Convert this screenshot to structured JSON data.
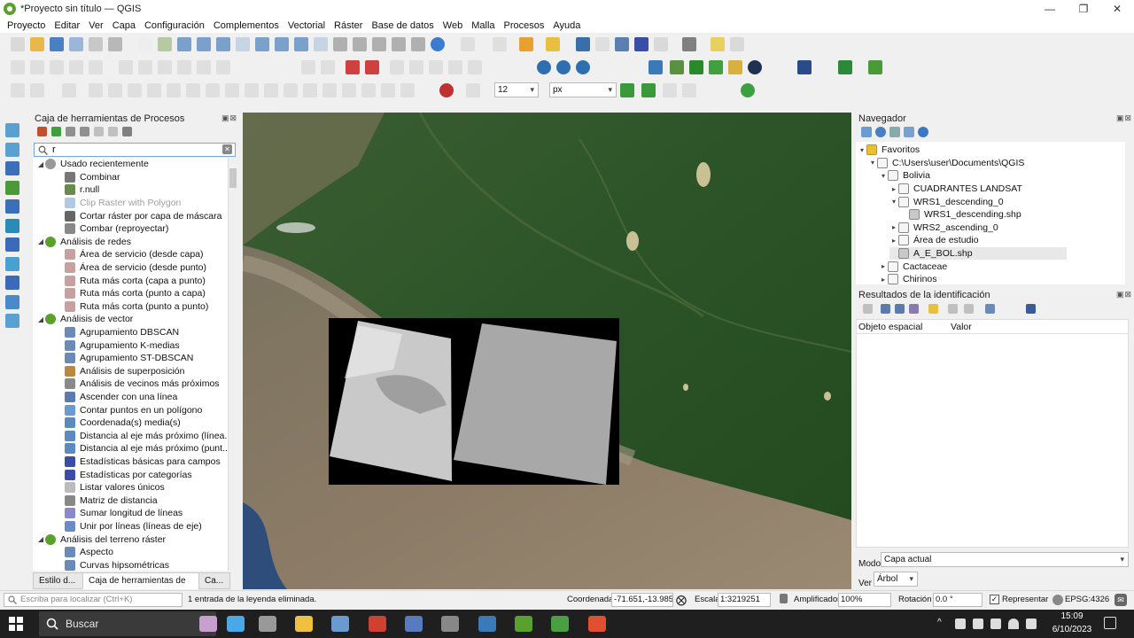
{
  "window": {
    "title": "*Proyecto sin título — QGIS",
    "controls": [
      "—",
      "❐",
      "✕"
    ]
  },
  "menu": [
    "Proyecto",
    "Editar",
    "Ver",
    "Capa",
    "Configuración",
    "Complementos",
    "Vectorial",
    "Ráster",
    "Base de datos",
    "Web",
    "Malla",
    "Procesos",
    "Ayuda"
  ],
  "toolbar": {
    "symbol_size_value": "12",
    "symbol_unit": "px"
  },
  "toolbox": {
    "title": "Caja de herramientas de Procesos",
    "search_value": "r",
    "groups": [
      {
        "label": "Usado recientemente",
        "icon": "clock-icon",
        "items": [
          {
            "label": "Combinar",
            "icon": "merge-icon",
            "disabled": false
          },
          {
            "label": "r.null",
            "icon": "grass-icon",
            "disabled": false
          },
          {
            "label": "Clip Raster with Polygon",
            "icon": "saga-icon",
            "disabled": true
          },
          {
            "label": "Cortar ráster por capa de máscara",
            "icon": "clip-raster-icon",
            "disabled": false
          },
          {
            "label": "Combar (reproyectar)",
            "icon": "warp-icon",
            "disabled": false
          }
        ]
      },
      {
        "label": "Análisis de redes",
        "icon": "qgis-icon",
        "items": [
          {
            "label": "Área de servicio (desde capa)",
            "icon": "network-icon",
            "disabled": false
          },
          {
            "label": "Área de servicio (desde punto)",
            "icon": "network-icon",
            "disabled": false
          },
          {
            "label": "Ruta más corta (capa a punto)",
            "icon": "network-icon",
            "disabled": false
          },
          {
            "label": "Ruta más corta (punto a capa)",
            "icon": "network-icon",
            "disabled": false
          },
          {
            "label": "Ruta más corta (punto a punto)",
            "icon": "network-icon",
            "disabled": false
          }
        ]
      },
      {
        "label": "Análisis de vector",
        "icon": "qgis-icon",
        "items": [
          {
            "label": "Agrupamiento DBSCAN",
            "icon": "gear-icon",
            "disabled": false
          },
          {
            "label": "Agrupamiento K-medias",
            "icon": "gear-icon",
            "disabled": false
          },
          {
            "label": "Agrupamiento ST-DBSCAN",
            "icon": "gear-icon",
            "disabled": false
          },
          {
            "label": "Análisis de superposición",
            "icon": "overlap-icon",
            "disabled": false
          },
          {
            "label": "Análisis de vecinos más próximos",
            "icon": "nearest-icon",
            "disabled": false
          },
          {
            "label": "Ascender con una línea",
            "icon": "line-icon",
            "disabled": false
          },
          {
            "label": "Contar puntos en un polígono",
            "icon": "count-points-icon",
            "disabled": false
          },
          {
            "label": "Coordenada(s) media(s)",
            "icon": "mean-coords-icon",
            "disabled": false
          },
          {
            "label": "Distancia al eje más próximo (línea...",
            "icon": "hub-icon",
            "disabled": false
          },
          {
            "label": "Distancia al eje más próximo (punt...",
            "icon": "hub-icon",
            "disabled": false
          },
          {
            "label": "Estadísticas básicas para campos",
            "icon": "sigma-icon",
            "disabled": false
          },
          {
            "label": "Estadísticas por categorías",
            "icon": "sigma-icon",
            "disabled": false
          },
          {
            "label": "Listar valores únicos",
            "icon": "unique-icon",
            "disabled": false
          },
          {
            "label": "Matriz de distancia",
            "icon": "matrix-icon",
            "disabled": false
          },
          {
            "label": "Sumar longitud de líneas",
            "icon": "sum-lines-icon",
            "disabled": false
          },
          {
            "label": "Unir por líneas (líneas de eje)",
            "icon": "join-lines-icon",
            "disabled": false
          }
        ]
      },
      {
        "label": "Análisis del terreno ráster",
        "icon": "qgis-icon",
        "items": [
          {
            "label": "Aspecto",
            "icon": "gear-icon",
            "disabled": false
          },
          {
            "label": "Curvas hipsométricas",
            "icon": "gear-icon",
            "disabled": false
          }
        ]
      }
    ],
    "tabs": [
      "Estilo d...",
      "Caja de herramientas de Pr...",
      "Ca..."
    ]
  },
  "navigator": {
    "title": "Navegador",
    "tree": [
      {
        "label": "Favoritos",
        "level": 0,
        "icon": "star-icon",
        "expanded": true
      },
      {
        "label": "C:\\Users\\user\\Documents\\QGIS",
        "level": 1,
        "icon": "folder-icon",
        "expanded": true
      },
      {
        "label": "Bolivia",
        "level": 2,
        "icon": "folder-icon",
        "expanded": true
      },
      {
        "label": "CUADRANTES LANDSAT",
        "level": 3,
        "icon": "folder-icon",
        "expanded": false
      },
      {
        "label": "WRS1_descending_0",
        "level": 3,
        "icon": "folder-icon",
        "expanded": true
      },
      {
        "label": "WRS1_descending.shp",
        "level": 4,
        "icon": "polygon-file-icon",
        "expanded": null
      },
      {
        "label": "WRS2_ascending_0",
        "level": 3,
        "icon": "folder-icon",
        "expanded": false
      },
      {
        "label": "Área de estudio",
        "level": 3,
        "icon": "folder-icon",
        "expanded": false
      },
      {
        "label": "A_E_BOL.shp",
        "level": 3,
        "icon": "polygon-file-icon",
        "expanded": null,
        "selected": true
      },
      {
        "label": "Cactaceae",
        "level": 2,
        "icon": "folder-icon",
        "expanded": false
      },
      {
        "label": "Chirinos",
        "level": 2,
        "icon": "folder-icon",
        "expanded": false
      }
    ]
  },
  "identify": {
    "title": "Resultados de la identificación",
    "columns": [
      "Objeto espacial",
      "Valor"
    ],
    "mode_label": "Modo",
    "mode_value": "Capa actual",
    "view_label": "Ver",
    "view_value": "Árbol"
  },
  "statusbar": {
    "locator_placeholder": "Escriba para localizar (Ctrl+K)",
    "message": "1 entrada de la leyenda eliminada.",
    "coord_label": "Coordenada",
    "coord_value": "-71.651,-13.985",
    "scale_label": "Escala",
    "scale_value": "1:3219251",
    "magnifier_label": "Amplificador",
    "magnifier_value": "100%",
    "rotation_label": "Rotación",
    "rotation_value": "0.0 °",
    "render_label": "Representar",
    "crs": "EPSG:4326"
  },
  "taskbar": {
    "search_label": "Buscar",
    "time": "15:09",
    "date": "6/10/2023"
  },
  "colors": {
    "qgis_green": "#5aa02c",
    "selection_blue": "#7aa7d9",
    "taskbar": "#1f1f1f"
  }
}
